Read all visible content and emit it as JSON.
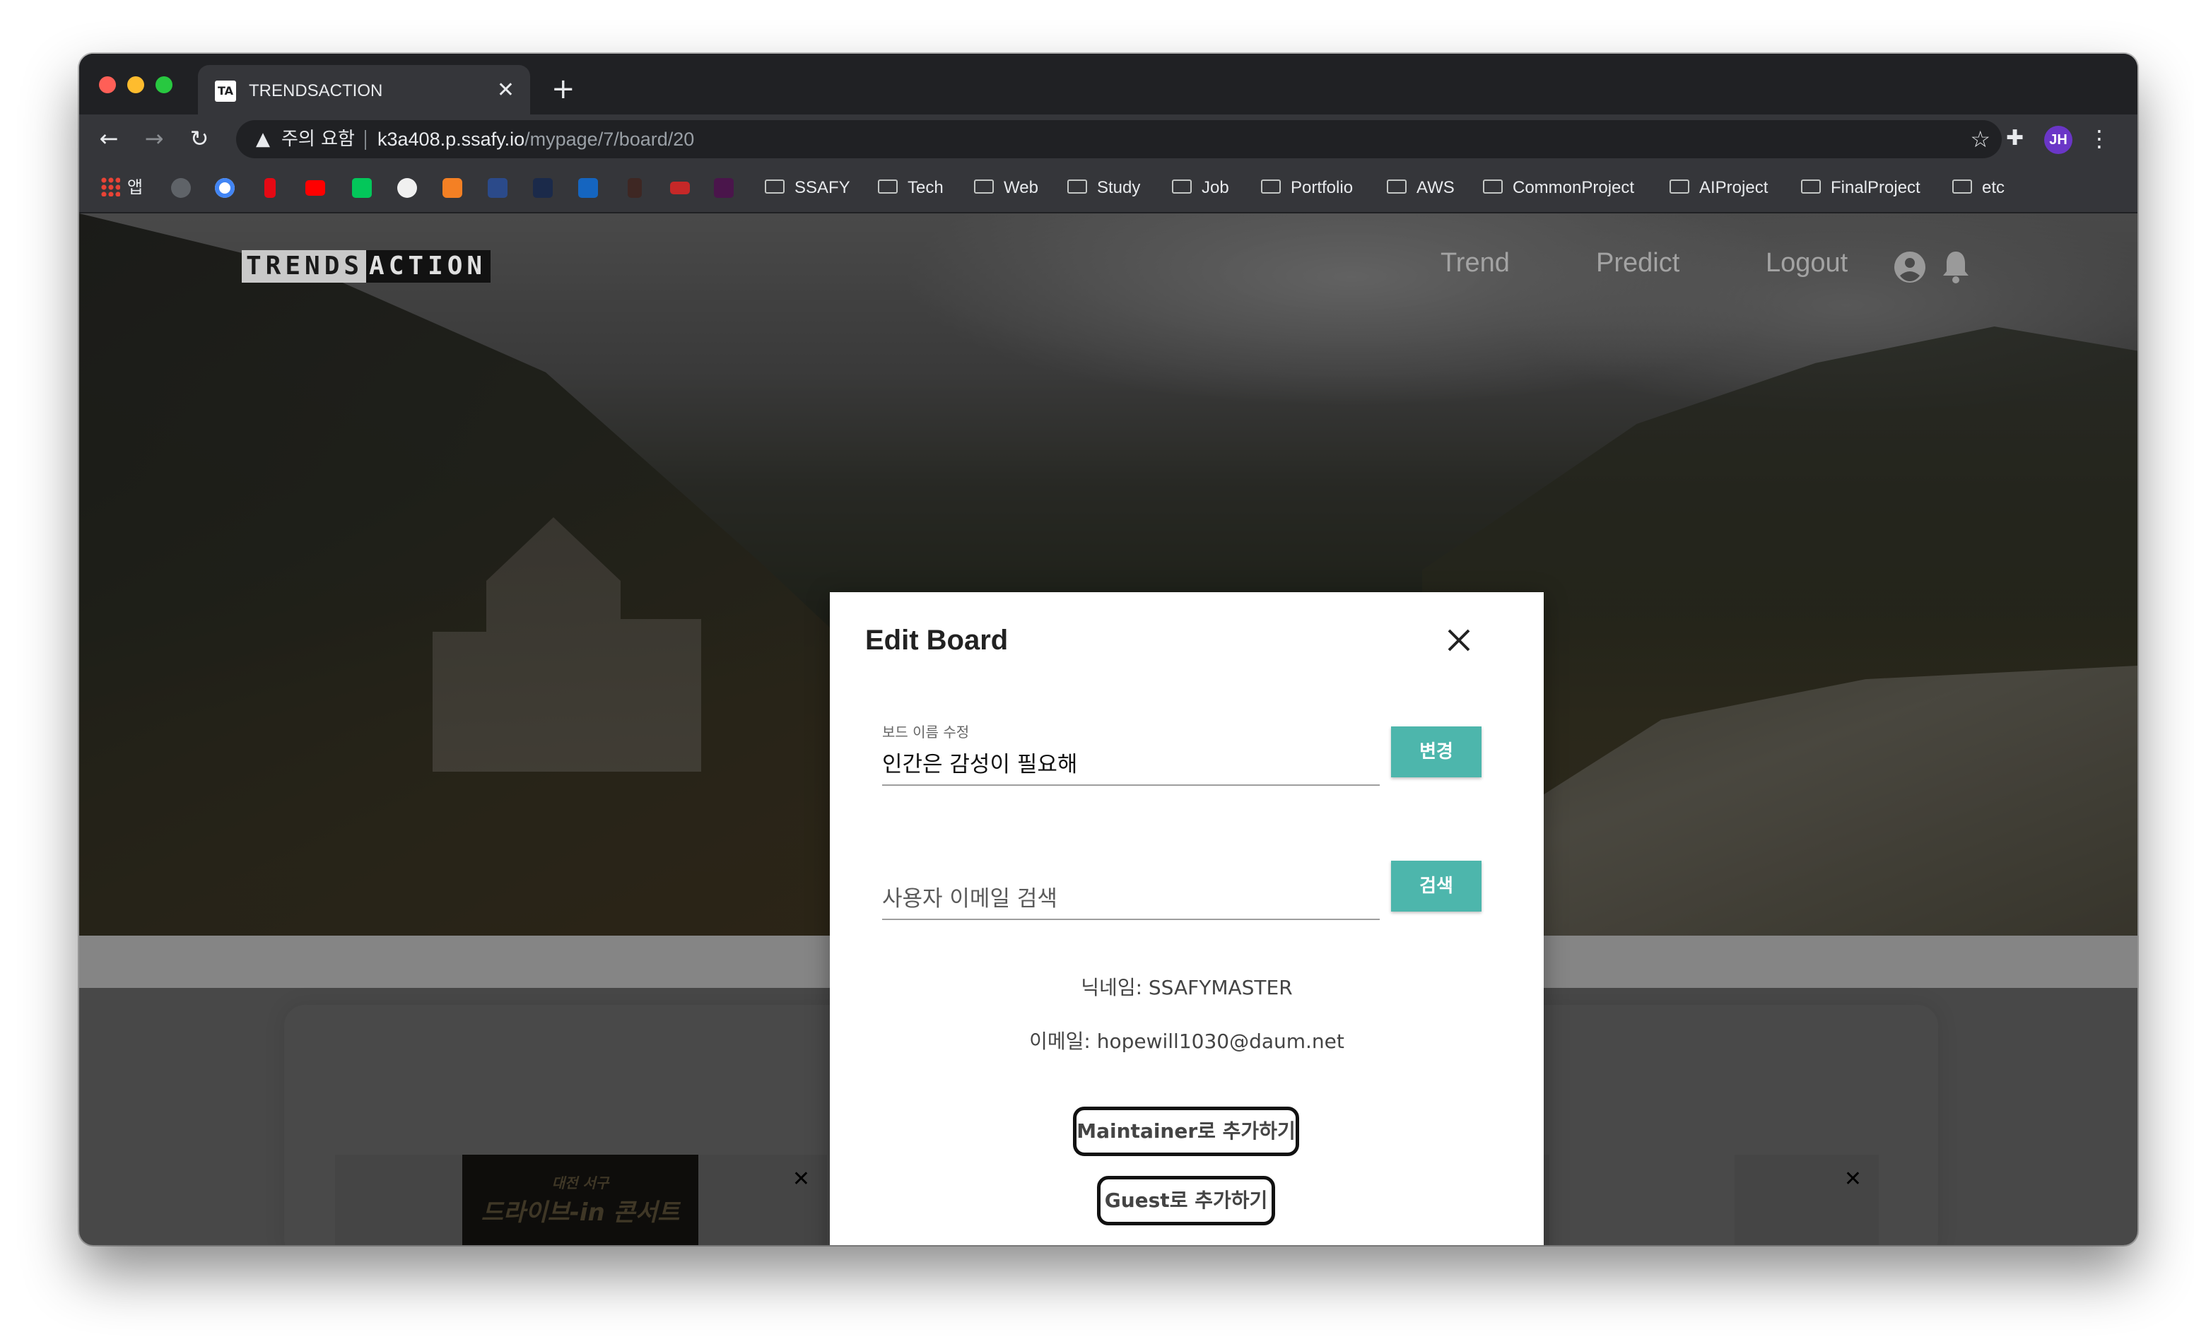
{
  "browser": {
    "tab_title": "TRENDSACTION",
    "tab_favicon_text": "TA",
    "new_tab_symbol": "+",
    "security_warning": "주의 요함",
    "url_host": "k3a408.p.ssafy.io",
    "url_path": "/mypage/7/board/20",
    "profile_initials": "JH",
    "bookmarks": [
      {
        "label": "앱",
        "icon": "apps-grid-icon"
      },
      {
        "label": "SSAFY",
        "icon": "folder-icon"
      },
      {
        "label": "Tech",
        "icon": "folder-icon"
      },
      {
        "label": "Web",
        "icon": "folder-icon"
      },
      {
        "label": "Study",
        "icon": "folder-icon"
      },
      {
        "label": "Job",
        "icon": "folder-icon"
      },
      {
        "label": "Portfolio",
        "icon": "folder-icon"
      },
      {
        "label": "AWS",
        "icon": "folder-icon"
      },
      {
        "label": "CommonProject",
        "icon": "folder-icon"
      },
      {
        "label": "AIProject",
        "icon": "folder-icon"
      },
      {
        "label": "FinalProject",
        "icon": "folder-icon"
      },
      {
        "label": "etc",
        "icon": "folder-icon"
      }
    ]
  },
  "site": {
    "logo_part1": "TRENDS",
    "logo_part2": "ACTION",
    "nav": {
      "trend": "Trend",
      "predict": "Predict",
      "logout": "Logout"
    }
  },
  "cards": {
    "concert_line1": "대전 서구",
    "concert_line2": "드라이브-in 콘서트"
  },
  "modal": {
    "title": "Edit Board",
    "board_name_label": "보드 이름 수정",
    "board_name_value": "인간은 감성이 필요해",
    "change_button": "변경",
    "search_placeholder": "사용자 이메일 검색",
    "search_button": "검색",
    "nickname_line": "닉네임: SSAFYMASTER",
    "email_line": "이메일: hopewill1030@daum.net",
    "add_maintainer_button": "Maintainer로 추가하기",
    "add_guest_button": "Guest로 추가하기"
  },
  "colors": {
    "accent_teal": "#4db6ac",
    "chrome_dark": "#202124",
    "profile_purple": "#6a36c7"
  }
}
